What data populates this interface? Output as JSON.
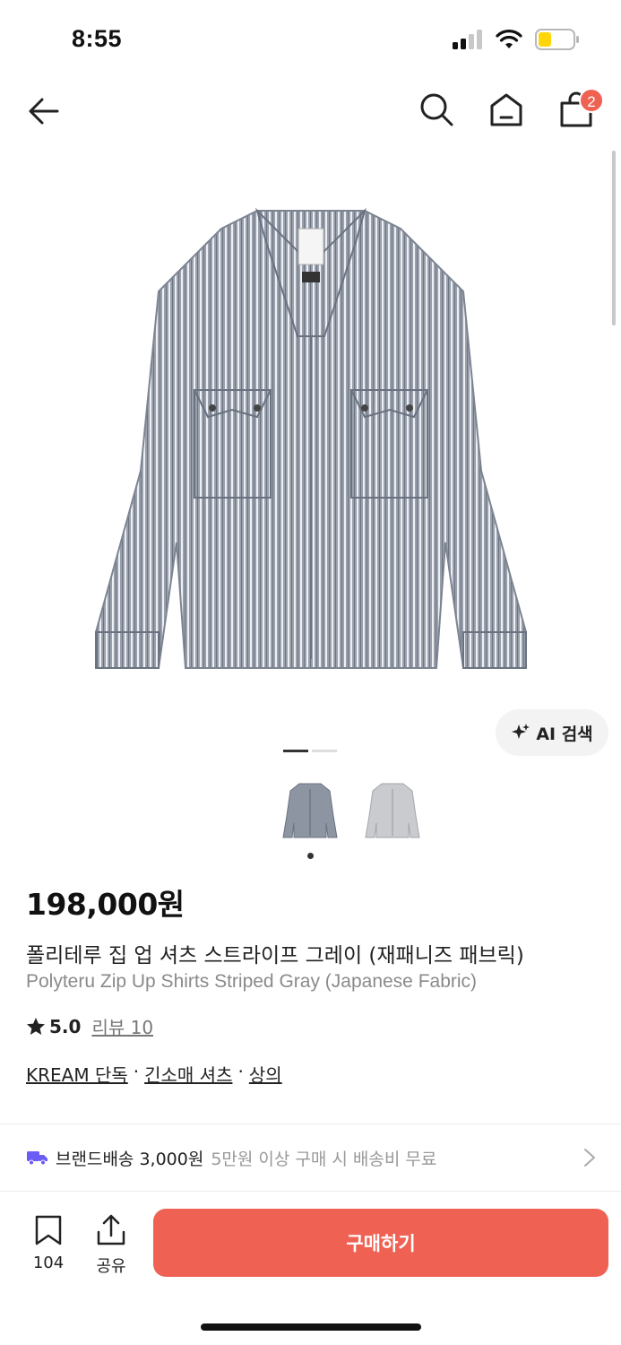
{
  "status_bar": {
    "time": "8:55"
  },
  "nav": {
    "cart_count": "2"
  },
  "ai_search": {
    "label": "AI 검색"
  },
  "product": {
    "price": "198,000원",
    "name_ko": "폴리테루 집 업 셔츠 스트라이프 그레이 (재패니즈 패브릭)",
    "name_en": "Polyteru Zip Up Shirts Striped Gray (Japanese Fabric)",
    "rating": "5.0",
    "review_label": "리뷰 10",
    "tags": [
      "KREAM 단독",
      "긴소매 셔츠",
      "상의"
    ],
    "tag_separator": "·"
  },
  "shipping": {
    "main": "브랜드배송 3,000원",
    "sub": "5만원 이상 구매 시 배송비 무료"
  },
  "bottom_bar": {
    "bookmark_count": "104",
    "share_label": "공유",
    "buy_label": "구매하기"
  },
  "colors": {
    "accent": "#ef6253",
    "shipping_icon": "#6b5cf6"
  }
}
